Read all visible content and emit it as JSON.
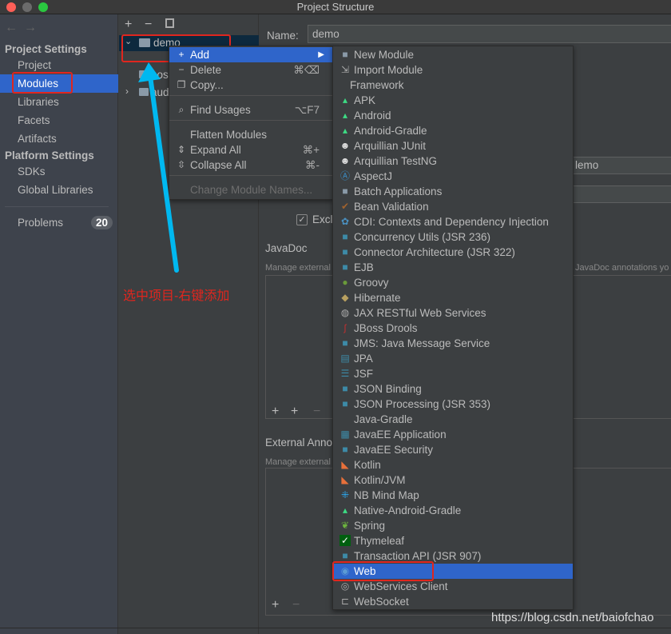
{
  "window": {
    "title": "Project Structure"
  },
  "sidebar": {
    "project_settings": "Project Settings",
    "items": [
      "Project",
      "Modules",
      "Libraries",
      "Facets",
      "Artifacts"
    ],
    "platform_settings": "Platform Settings",
    "platform_items": [
      "SDKs",
      "Global Libraries"
    ],
    "problems": "Problems",
    "problems_count": "20",
    "selected": "Modules"
  },
  "tree": {
    "root": "demo",
    "child1": "pos",
    "child2": "aud"
  },
  "context_menu": {
    "items": [
      {
        "label": "Add",
        "icon": "plus-icon",
        "shortcut": "",
        "submenu": true
      },
      {
        "label": "Delete",
        "icon": "minus-icon",
        "shortcut": "⌘⌫"
      },
      {
        "label": "Copy...",
        "icon": "copy-icon",
        "shortcut": ""
      },
      {
        "label": "Find Usages",
        "icon": "search-icon",
        "shortcut": "⌥F7"
      },
      {
        "label": "Flatten Modules",
        "icon": "",
        "shortcut": ""
      },
      {
        "label": "Expand All",
        "icon": "expand-icon",
        "shortcut": "⌘+"
      },
      {
        "label": "Collapse All",
        "icon": "collapse-icon",
        "shortcut": "⌘-"
      },
      {
        "label": "Change Module Names...",
        "icon": "",
        "shortcut": "",
        "disabled": true
      }
    ]
  },
  "submenu": {
    "selected": "Web",
    "items": [
      {
        "label": "New Module",
        "icon": "module-icon"
      },
      {
        "label": "Import Module",
        "icon": "import-icon"
      },
      {
        "label": "Framework",
        "icon": ""
      },
      {
        "label": "APK",
        "icon": "android-icon"
      },
      {
        "label": "Android",
        "icon": "android-icon"
      },
      {
        "label": "Android-Gradle",
        "icon": "android-icon"
      },
      {
        "label": "Arquillian JUnit",
        "icon": "arquillian-icon"
      },
      {
        "label": "Arquillian TestNG",
        "icon": "arquillian-icon"
      },
      {
        "label": "AspectJ",
        "icon": "aspectj-icon"
      },
      {
        "label": "Batch Applications",
        "icon": "folder-icon"
      },
      {
        "label": "Bean Validation",
        "icon": "bean-icon"
      },
      {
        "label": "CDI: Contexts and Dependency Injection",
        "icon": "cdi-icon"
      },
      {
        "label": "Concurrency Utils (JSR 236)",
        "icon": "javaee-icon"
      },
      {
        "label": "Connector Architecture (JSR 322)",
        "icon": "javaee-icon"
      },
      {
        "label": "EJB",
        "icon": "javaee-icon"
      },
      {
        "label": "Groovy",
        "icon": "groovy-icon"
      },
      {
        "label": "Hibernate",
        "icon": "hibernate-icon"
      },
      {
        "label": "JAX RESTful Web Services",
        "icon": "globe-icon"
      },
      {
        "label": "JBoss Drools",
        "icon": "drools-icon"
      },
      {
        "label": "JMS: Java Message Service",
        "icon": "javaee-icon"
      },
      {
        "label": "JPA",
        "icon": "jpa-icon"
      },
      {
        "label": "JSF",
        "icon": "jsf-icon"
      },
      {
        "label": "JSON Binding",
        "icon": "javaee-icon"
      },
      {
        "label": "JSON Processing (JSR 353)",
        "icon": "javaee-icon"
      },
      {
        "label": "Java-Gradle",
        "icon": ""
      },
      {
        "label": "JavaEE Application",
        "icon": "javaee-app-icon"
      },
      {
        "label": "JavaEE Security",
        "icon": "javaee-icon"
      },
      {
        "label": "Kotlin",
        "icon": "kotlin-icon"
      },
      {
        "label": "Kotlin/JVM",
        "icon": "kotlin-icon"
      },
      {
        "label": "NB Mind Map",
        "icon": "mindmap-icon"
      },
      {
        "label": "Native-Android-Gradle",
        "icon": "android-icon"
      },
      {
        "label": "Spring",
        "icon": "spring-icon"
      },
      {
        "label": "Thymeleaf",
        "icon": "thymeleaf-icon"
      },
      {
        "label": "Transaction API (JSR 907)",
        "icon": "javaee-icon"
      },
      {
        "label": "Web",
        "icon": "web-icon"
      },
      {
        "label": "WebServices Client",
        "icon": "webservices-icon"
      },
      {
        "label": "WebSocket",
        "icon": "websocket-icon"
      }
    ]
  },
  "details": {
    "name_label": "Name:",
    "name_value": "demo",
    "field_partial": "lemo",
    "exclude_label": "Excl",
    "javadoc_label": "JavaDoc",
    "manage_external": "Manage external",
    "javadoc_hint": "JavaDoc annotations yo",
    "external_annot": "External Annot",
    "manage_external2": "Manage external"
  },
  "annotation": {
    "text": "选中项目-右键添加",
    "color": "#e0261e",
    "arrow_color": "#00b8f0"
  },
  "watermark": "https://blog.csdn.net/baiofchao"
}
